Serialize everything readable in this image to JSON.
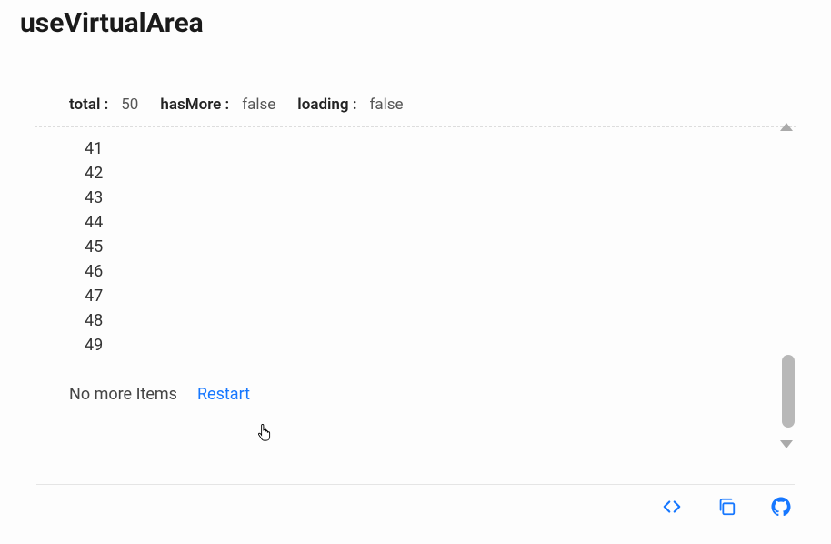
{
  "title": "useVirtualArea",
  "status": {
    "total_label": "total :",
    "total_value": "50",
    "hasMore_label": "hasMore :",
    "hasMore_value": "false",
    "loading_label": "loading :",
    "loading_value": "false"
  },
  "items": [
    "41",
    "42",
    "43",
    "44",
    "45",
    "46",
    "47",
    "48",
    "49"
  ],
  "footer": {
    "no_more": "No more Items",
    "restart": "Restart"
  },
  "colors": {
    "link": "#1677ff"
  }
}
